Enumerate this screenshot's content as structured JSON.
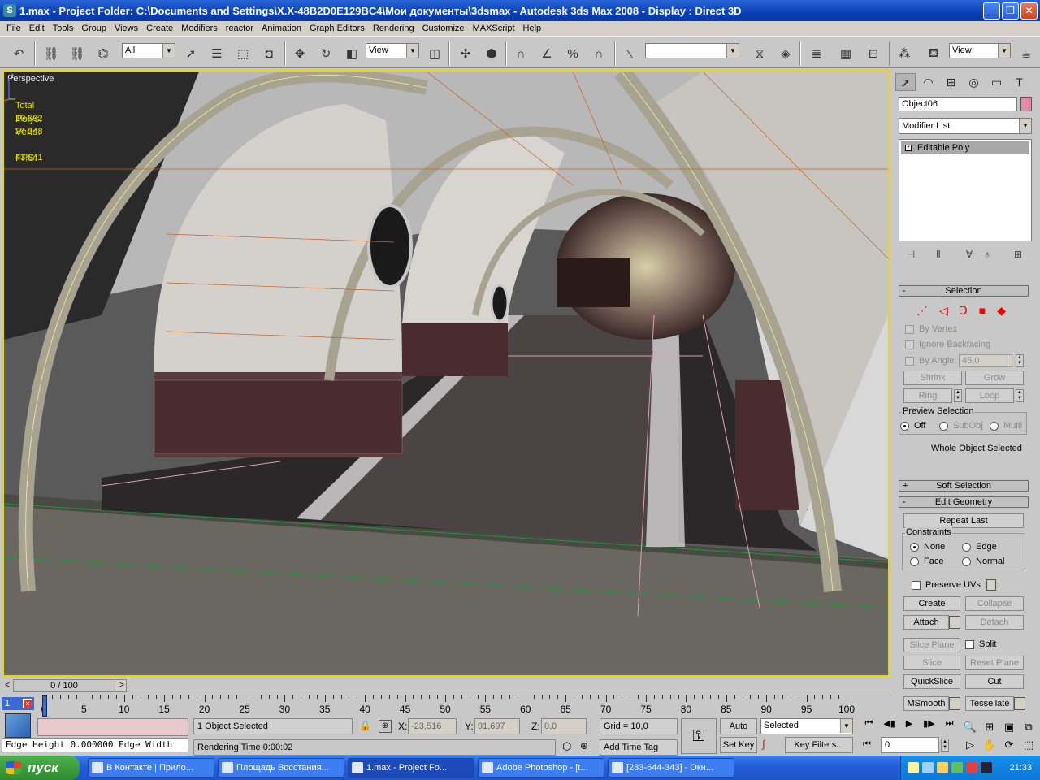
{
  "window": {
    "title": "1.max      - Project Folder: C:\\Documents and Settings\\X.X-48B2D0E129BC4\\Мои документы\\3dsmax      - Autodesk 3ds Max 2008        - Display : Direct 3D",
    "buttons": [
      "_",
      "❐",
      "✕"
    ]
  },
  "menu": [
    "File",
    "Edit",
    "Tools",
    "Group",
    "Views",
    "Create",
    "Modifiers",
    "reactor",
    "Animation",
    "Graph Editors",
    "Rendering",
    "Customize",
    "MAXScript",
    "Help"
  ],
  "toolbar": {
    "selection_filter": "All",
    "ref_coord": "View",
    "named_selection": "",
    "render_view": "View"
  },
  "viewport": {
    "label": "Perspective",
    "stats": {
      "header": "Total",
      "polys_label": "Polys:",
      "polys": "19 992",
      "verts_label": "Verts:",
      "verts": "24 248",
      "fps_label": "FPS:",
      "fps": "43,041"
    },
    "axis_z": "z"
  },
  "panel": {
    "object_name": "Object06",
    "object_color": "#e48aa6",
    "modifier_list": "Modifier List",
    "stack_item": "Editable Poly",
    "selection": {
      "title": "Selection",
      "by_vertex": "By Vertex",
      "ignore_backfacing": "Ignore Backfacing",
      "by_angle": "By Angle:",
      "angle_value": "45,0",
      "shrink": "Shrink",
      "grow": "Grow",
      "ring": "Ring",
      "loop": "Loop",
      "preview_title": "Preview Selection",
      "off": "Off",
      "subobj": "SubObj",
      "multi": "Multi",
      "status": "Whole Object Selected"
    },
    "soft_selection": "Soft Selection",
    "edit_geometry": {
      "title": "Edit Geometry",
      "repeat_last": "Repeat Last",
      "constraints": "Constraints",
      "none": "None",
      "edge": "Edge",
      "face": "Face",
      "normal": "Normal",
      "preserve_uvs": "Preserve UVs",
      "create": "Create",
      "collapse": "Collapse",
      "attach": "Attach",
      "detach": "Detach",
      "slice_plane": "Slice Plane",
      "split": "Split",
      "slice": "Slice",
      "reset_plane": "Reset Plane",
      "quickslice": "QuickSlice",
      "cut": "Cut",
      "msmooth": "MSmooth",
      "tessellate": "Tessellate"
    }
  },
  "timeline": {
    "slider": "0 / 100",
    "ticks": [
      "0",
      "5",
      "10",
      "15",
      "20",
      "25",
      "30",
      "35",
      "40",
      "45",
      "50",
      "55",
      "60",
      "65",
      "70",
      "75",
      "80",
      "85",
      "90",
      "95",
      "100"
    ]
  },
  "status": {
    "maxscript_num": "1",
    "maxscript_text": "Edge Height 0.000000 Edge Width",
    "selected": "1 Object Selected",
    "rendering_time": "Rendering Time  0:00:02",
    "x_label": "X:",
    "x": "-23,516",
    "y_label": "Y:",
    "y": "91,697",
    "z_label": "Z:",
    "z": "0,0",
    "grid": "Grid = 10,0",
    "add_time_tag": "Add Time Tag",
    "auto_key": "Auto Key",
    "set_key": "Set Key",
    "key_mode": "Selected",
    "key_filters": "Key Filters...",
    "frame": "0"
  },
  "taskbar": {
    "start": "пуск",
    "tasks": [
      "В Контакте | Прило...",
      "Площадь Восстания...",
      "1.max      - Project Fo...",
      "Adobe Photoshop - [t...",
      "[283-644-343] - Окн..."
    ],
    "clock": "21:33"
  }
}
